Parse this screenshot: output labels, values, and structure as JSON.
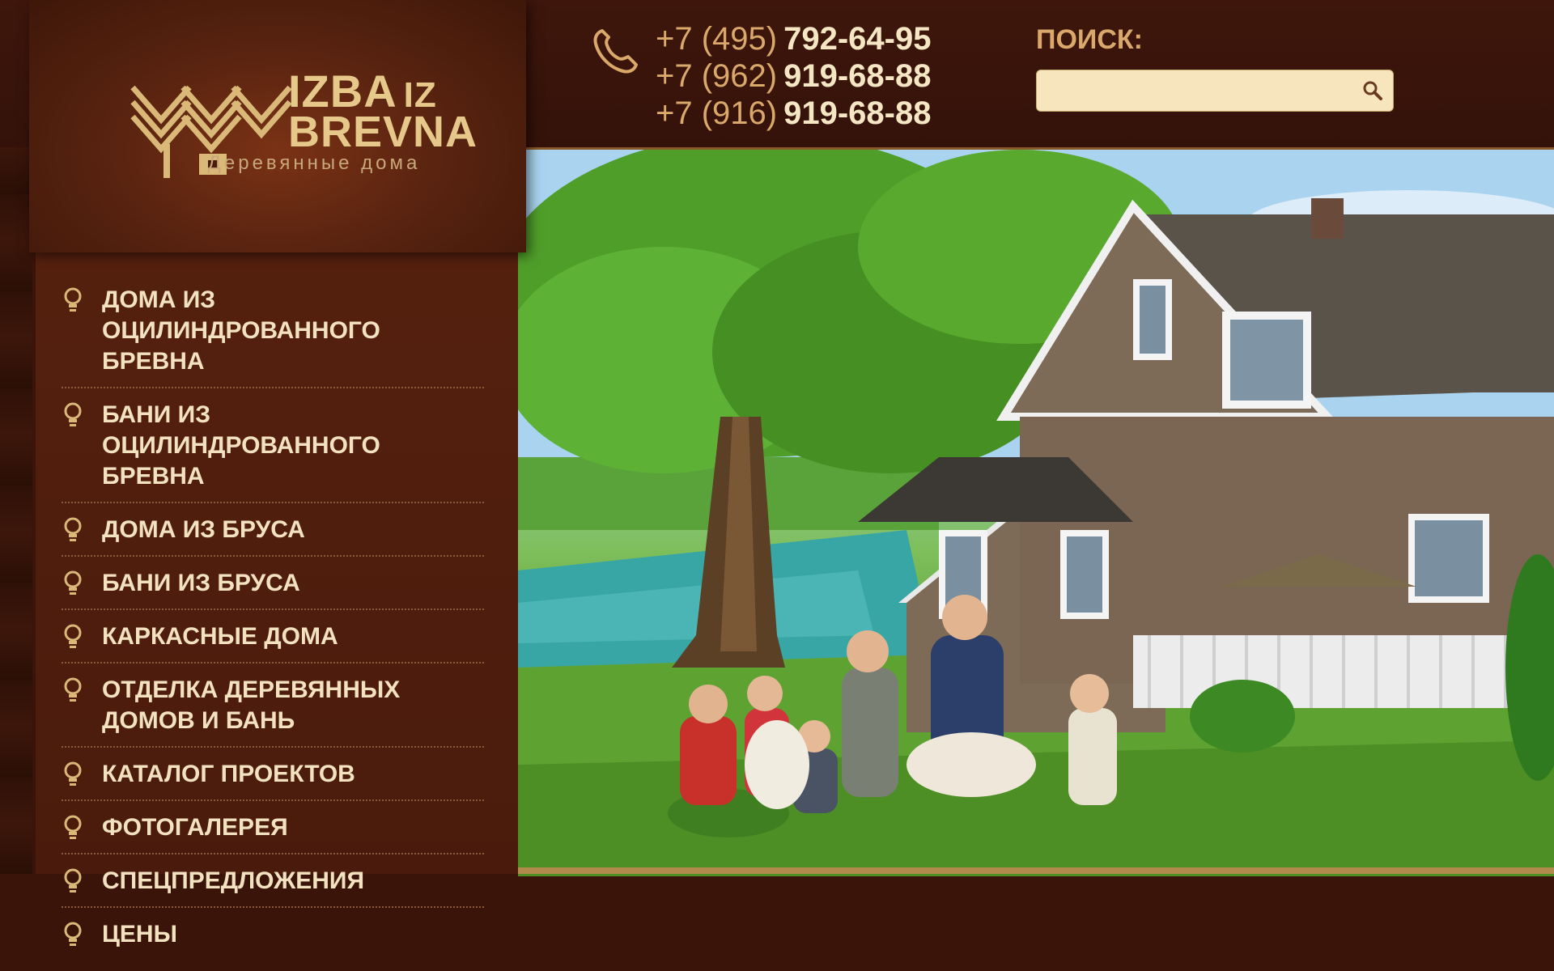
{
  "logo": {
    "line1": "IZBA",
    "line1_small": "IZ",
    "line2": "BREVNA",
    "tagline": "Деревянные дома"
  },
  "phones": [
    {
      "code": "+7 (495)",
      "number": "792-64-95"
    },
    {
      "code": "+7 (962)",
      "number": "919-68-88"
    },
    {
      "code": "+7 (916)",
      "number": "919-68-88"
    }
  ],
  "search": {
    "label": "ПОИСК:",
    "placeholder": "",
    "value": ""
  },
  "menu": [
    {
      "label": "ДОМА ИЗ ОЦИЛИНДРОВАННОГО БРЕВНА"
    },
    {
      "label": "БАНИ ИЗ ОЦИЛИНДРОВАННОГО БРЕВНА"
    },
    {
      "label": "ДОМА ИЗ БРУСА"
    },
    {
      "label": "БАНИ ИЗ БРУСА"
    },
    {
      "label": "КАРКАСНЫЕ ДОМА"
    },
    {
      "label": "ОТДЕЛКА ДЕРЕВЯННЫХ ДОМОВ И БАНЬ"
    },
    {
      "label": "КАТАЛОГ ПРОЕКТОВ"
    },
    {
      "label": "ФОТОГАЛЕРЕЯ"
    },
    {
      "label": "СПЕЦПРЕДЛОЖЕНИЯ"
    },
    {
      "label": "ЦЕНЫ"
    }
  ],
  "icons": {
    "phone": "phone-icon",
    "search": "magnifier-icon",
    "menu_bullet": "lightbulb-icon"
  },
  "colors": {
    "background": "#3a1409",
    "accent_gold": "#d9a86a",
    "menu_text": "#f3e2c0",
    "search_field": "#f7e6bd"
  }
}
